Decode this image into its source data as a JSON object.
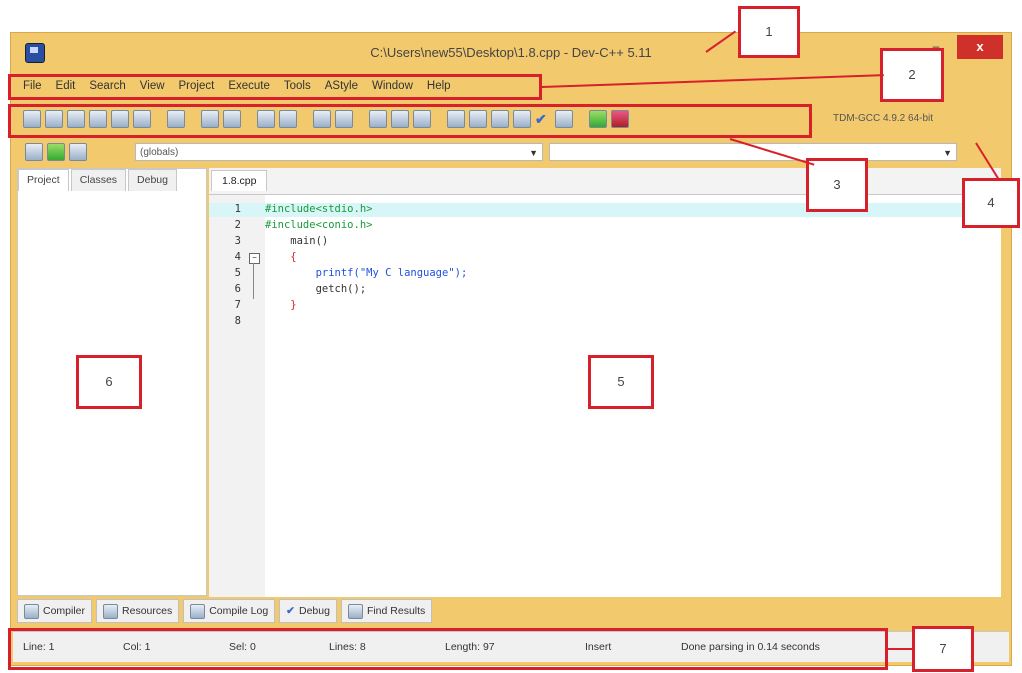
{
  "window": {
    "title": "C:\\Users\\new55\\Desktop\\1.8.cpp - Dev-C++ 5.11",
    "minimize": "–",
    "close": "x"
  },
  "menu": [
    "File",
    "Edit",
    "Search",
    "View",
    "Project",
    "Execute",
    "Tools",
    "AStyle",
    "Window",
    "Help"
  ],
  "compiler": "TDM-GCC 4.9.2 64-bit",
  "class_combo": "(globals)",
  "left_tabs": [
    "Project",
    "Classes",
    "Debug"
  ],
  "editor": {
    "tab": "1.8.cpp",
    "lines": [
      {
        "n": "1",
        "code": "#include<stdio.h>"
      },
      {
        "n": "2",
        "code": "#include<conio.h>"
      },
      {
        "n": "3",
        "code": "    main()"
      },
      {
        "n": "4",
        "code": "    {"
      },
      {
        "n": "5",
        "code": "        printf(\"My C language\");"
      },
      {
        "n": "6",
        "code": "        getch();"
      },
      {
        "n": "7",
        "code": "    }"
      },
      {
        "n": "8",
        "code": ""
      }
    ]
  },
  "bottom_tabs": [
    "Compiler",
    "Resources",
    "Compile Log",
    "Debug",
    "Find Results"
  ],
  "status": {
    "line": "Line: 1",
    "col": "Col: 1",
    "sel": "Sel: 0",
    "lines": "Lines: 8",
    "length": "Length: 97",
    "mode": "Insert",
    "message": "Done parsing in 0.14 seconds"
  },
  "annotations": [
    "1",
    "2",
    "3",
    "4",
    "5",
    "6",
    "7"
  ],
  "colors": {
    "frame": "#f3c96e",
    "annotation": "#d8202a",
    "close_button": "#d0302a",
    "preprocessor": "#1a9a3a",
    "string": "#2050e0",
    "bracket": "#e02020",
    "current_line": "#d8f6f8"
  }
}
